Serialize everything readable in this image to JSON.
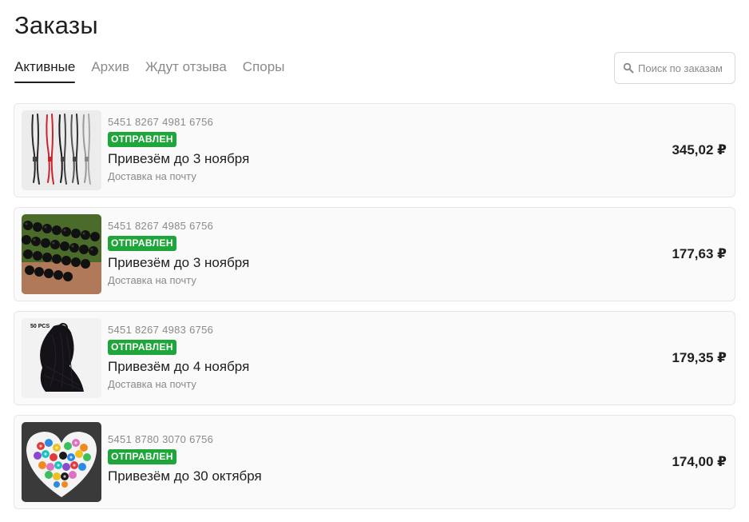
{
  "page": {
    "title": "Заказы"
  },
  "tabs": [
    {
      "label": "Активные",
      "active": true
    },
    {
      "label": "Архив",
      "active": false
    },
    {
      "label": "Ждут отзыва",
      "active": false
    },
    {
      "label": "Споры",
      "active": false
    }
  ],
  "search": {
    "placeholder": "Поиск по заказам",
    "value": ""
  },
  "colors": {
    "status_green": "#1ea63a",
    "text_primary": "#1f1f1f",
    "text_secondary": "#8a8a8a"
  },
  "orders": [
    {
      "number": "5451 8267 4981 6756",
      "status": "ОТПРАВЛЕН",
      "delivery_date": "Привезём до 3 ноября",
      "delivery_method": "Доставка на почту",
      "price": "345,02 ₽",
      "image": "lanyard-straps-image"
    },
    {
      "number": "5451 8267 4985 6756",
      "status": "ОТПРАВЛЕН",
      "delivery_date": "Привезём до 3 ноября",
      "delivery_method": "Доставка на почту",
      "price": "177,63 ₽",
      "image": "black-beads-image"
    },
    {
      "number": "5451 8267 4983 6756",
      "status": "ОТПРАВЛЕН",
      "delivery_date": "Привезём до 4 ноября",
      "delivery_method": "Доставка на почту",
      "price": "179,35 ₽",
      "image": "black-cords-image",
      "image_caption": "50 PCS"
    },
    {
      "number": "5451 8780 3070 6756",
      "status": "ОТПРАВЛЕН",
      "delivery_date": "Привезём до 30 октября",
      "price": "174,00 ₽",
      "image": "colorful-beads-heart-dish-image"
    }
  ]
}
